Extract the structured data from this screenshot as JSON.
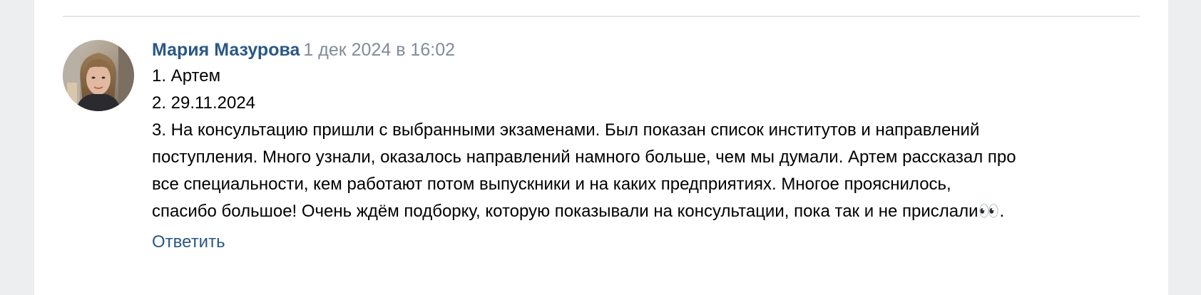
{
  "comment": {
    "author": "Мария Мазурова",
    "date": "1 дек 2024 в 16:02",
    "lines": [
      "1. Артем",
      "2. 29.11.2024",
      "3. На консультацию пришли с выбранными экзаменами. Был показан список институтов и направлений",
      "поступления. Много узнали, оказалось направлений намного больше, чем мы думали. Артем рассказал про",
      "все специальности, кем работают потом выпускники и на каких предприятиях. Многое прояснилось,",
      "спасибо большое! Очень ждём подборку, которую показывали на консультации, пока так и не прислали👀."
    ],
    "reply_label": "Ответить"
  },
  "colors": {
    "link": "#2a5885",
    "muted": "#818c99",
    "background": "#edeef0",
    "card": "#ffffff"
  }
}
